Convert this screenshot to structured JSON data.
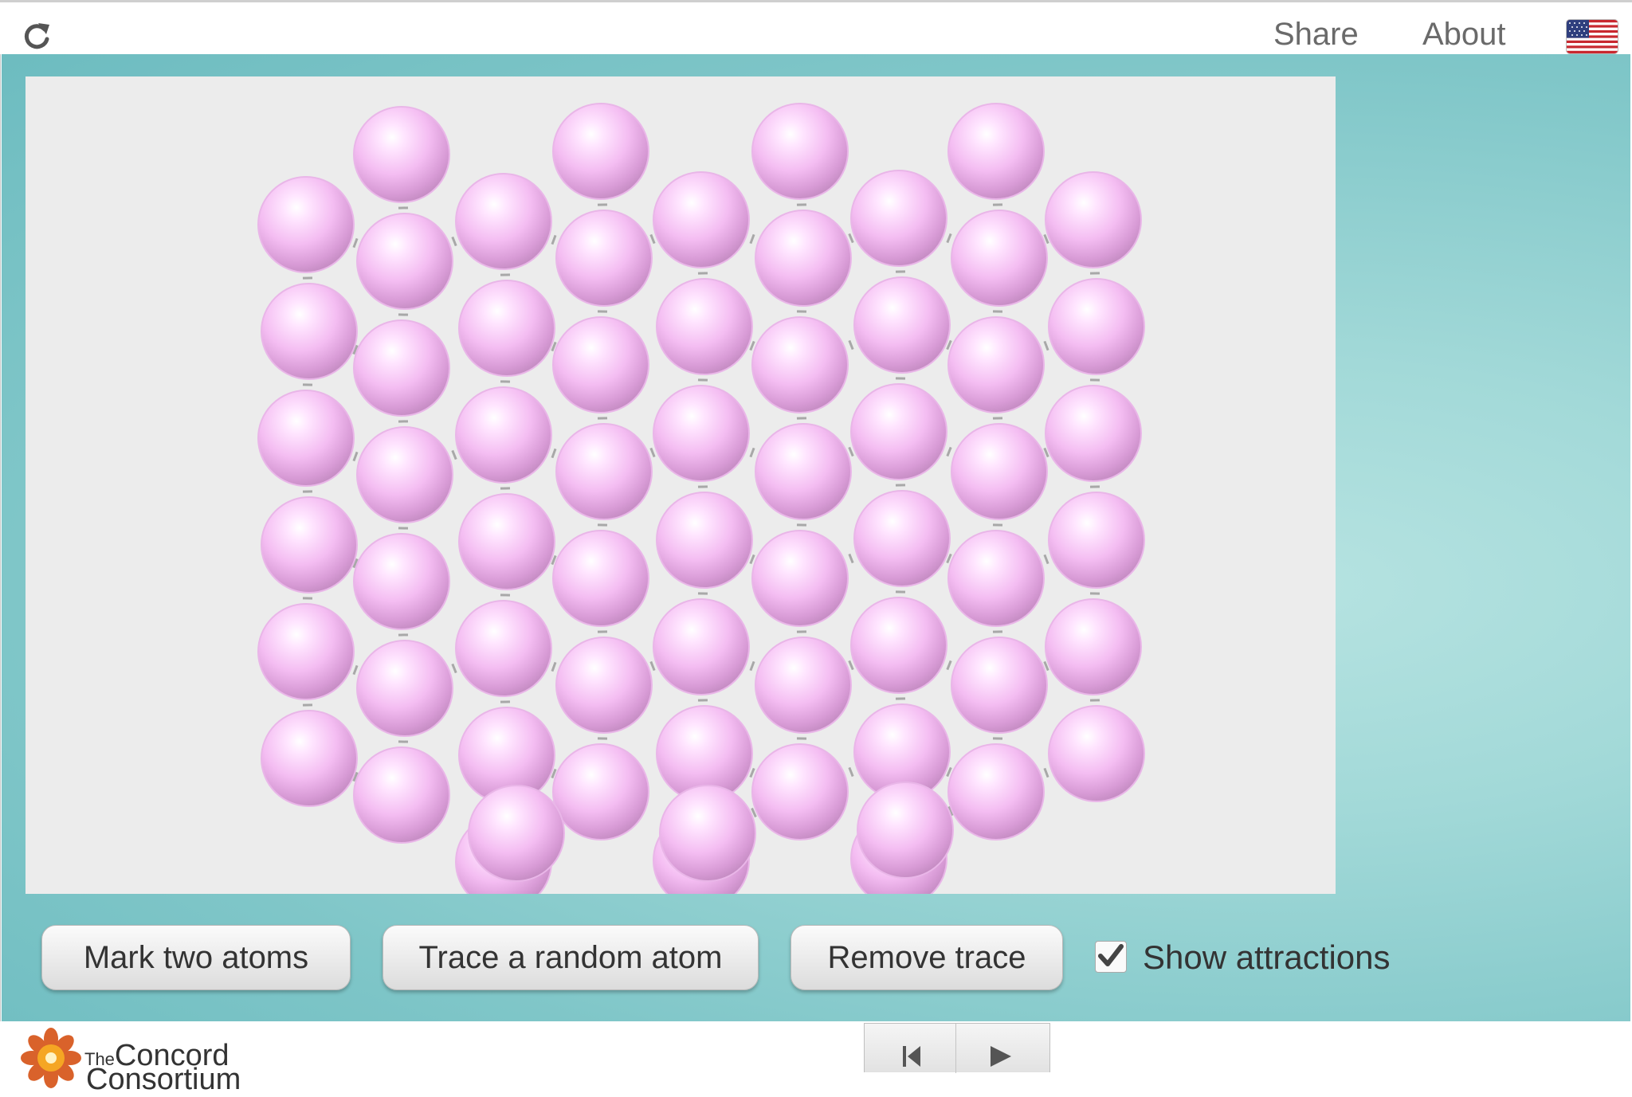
{
  "header": {
    "reload_icon": "reload-icon",
    "share_label": "Share",
    "about_label": "About",
    "language_icon": "us-flag-icon"
  },
  "model": {
    "background": "#ececec",
    "atom_color": "#f0b6ee",
    "atom_count": 58
  },
  "controls": {
    "mark_two_atoms_label": "Mark two atoms",
    "trace_random_atom_label": "Trace a random atom",
    "remove_trace_label": "Remove trace",
    "show_attractions": {
      "label": "Show attractions",
      "checked": true
    }
  },
  "footer": {
    "logo_line1_small": "The",
    "logo_line1": "Concord",
    "logo_line2": "Consortium",
    "player_icons": [
      "step-back-icon",
      "play-icon"
    ]
  },
  "colors": {
    "teal": "#7fc6c8",
    "button_text": "#333333",
    "link_text": "#6a6a6a"
  }
}
